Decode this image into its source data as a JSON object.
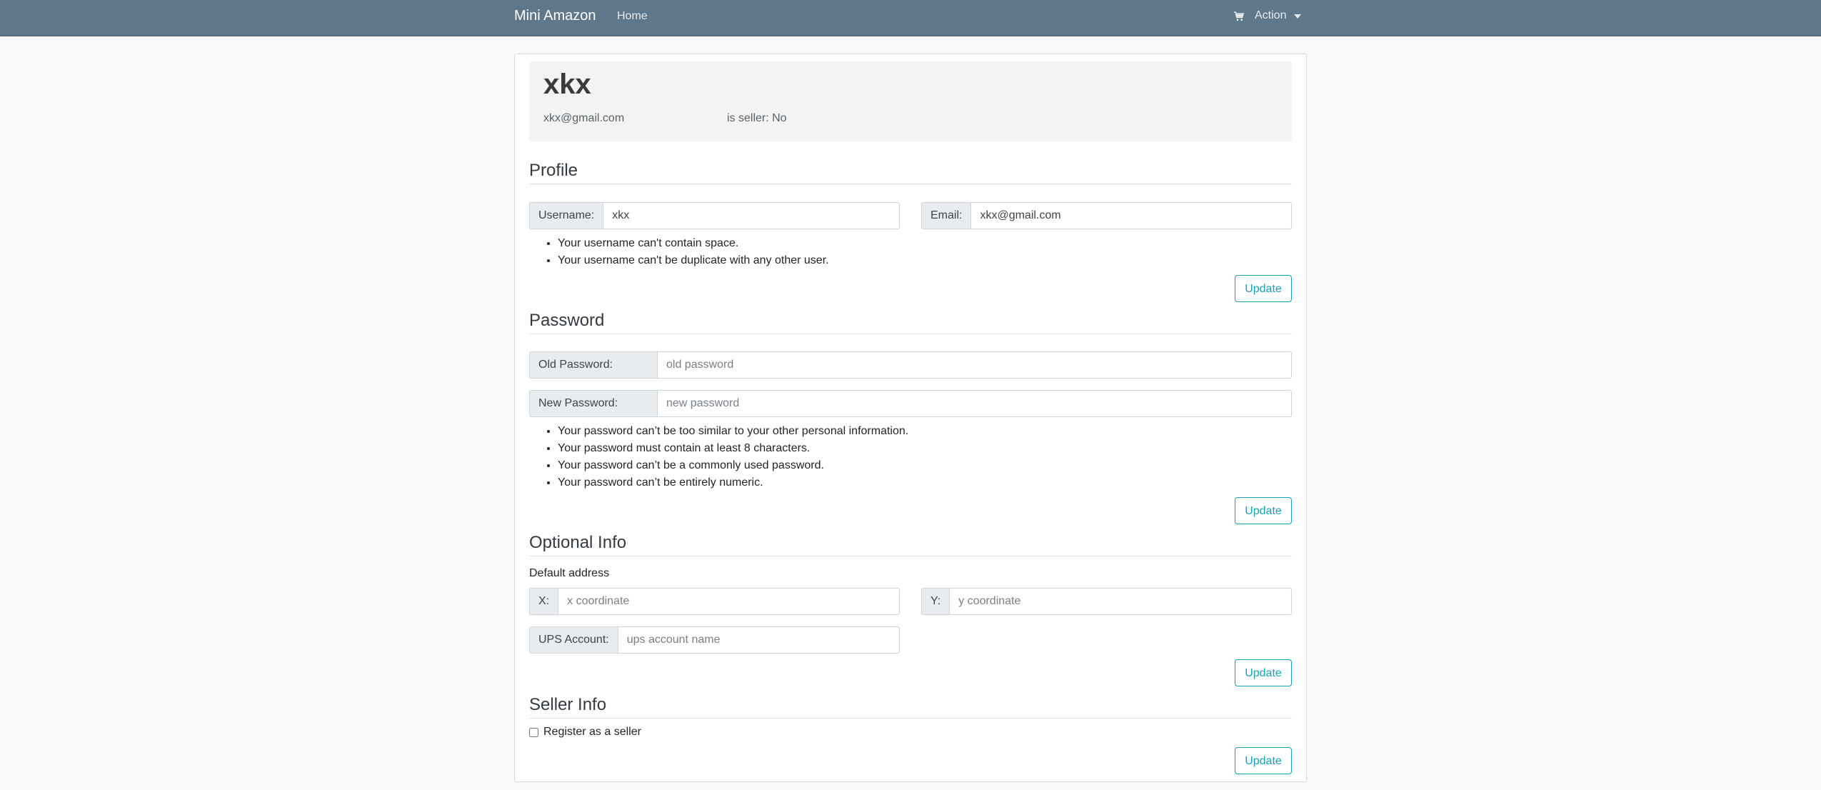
{
  "nav": {
    "brand": "Mini Amazon",
    "home": "Home",
    "action": "Action",
    "cart_icon": "cart-icon"
  },
  "user": {
    "name": "xkx",
    "email": "xkx@gmail.com",
    "seller_status": "is seller: No"
  },
  "profile": {
    "title": "Profile",
    "username_label": "Username:",
    "username_value": "xkx",
    "email_label": "Email:",
    "email_value": "xkx@gmail.com",
    "hints": [
      "Your username can't contain space.",
      "Your username can't be duplicate with any other user."
    ],
    "update_label": "Update"
  },
  "password": {
    "title": "Password",
    "old_label": "Old Password:",
    "old_placeholder": "old password",
    "new_label": "New Password:",
    "new_placeholder": "new password",
    "hints": [
      "Your password can’t be too similar to your other personal information.",
      "Your password must contain at least 8 characters.",
      "Your password can’t be a commonly used password.",
      "Your password can’t be entirely numeric."
    ],
    "update_label": "Update"
  },
  "optional": {
    "title": "Optional Info",
    "address_label": "Default address",
    "x_label": "X:",
    "x_placeholder": "x coordinate",
    "y_label": "Y:",
    "y_placeholder": "y coordinate",
    "ups_label": "UPS Account:",
    "ups_placeholder": "ups account name",
    "update_label": "Update"
  },
  "seller": {
    "title": "Seller Info",
    "register_label": "Register as a seller",
    "register_checked": false,
    "update_label": "Update"
  },
  "colors": {
    "navbar": "#5e778b",
    "accent": "#17a2b8",
    "background": "#f8f8f8"
  }
}
